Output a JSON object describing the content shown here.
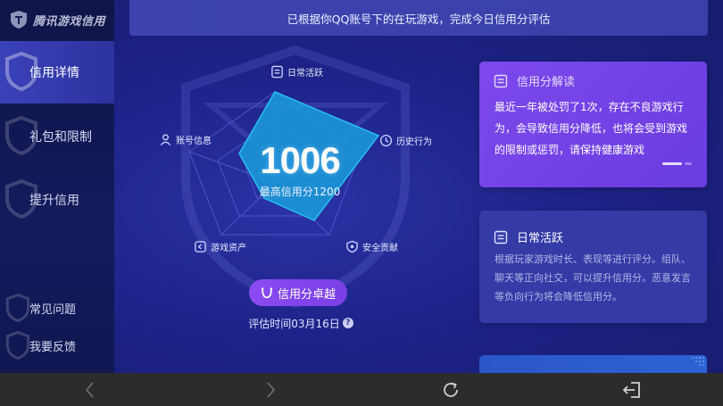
{
  "app": {
    "logo_text": "腾讯游戏信用"
  },
  "sidebar": {
    "items": [
      {
        "label": "信用详情",
        "active": true
      },
      {
        "label": "礼包和限制",
        "active": false
      },
      {
        "label": "提升信用",
        "active": false
      }
    ],
    "bottom_items": [
      {
        "label": "常见问题"
      },
      {
        "label": "我要反馈"
      }
    ]
  },
  "banner": {
    "text": "已根据你QQ账号下的在玩游戏，完成今日信用分评估"
  },
  "radar": {
    "dimensions": [
      {
        "label": "日常活跃",
        "icon": "list-icon"
      },
      {
        "label": "历史行为",
        "icon": "clock-icon"
      },
      {
        "label": "安全贡献",
        "icon": "shield-icon"
      },
      {
        "label": "游戏资产",
        "icon": "asset-icon"
      },
      {
        "label": "账号信息",
        "icon": "user-icon"
      }
    ],
    "score": "1006",
    "max_label": "最高信用分1200",
    "level_label": "信用分卓越",
    "eval_time": "评估时间03月16日",
    "help": "?"
  },
  "cards": {
    "interpretation": {
      "title": "信用分解读",
      "body": "最近一年被处罚了1次，存在不良游戏行为，会导致信用分降低，也将会受到游戏的限制或惩罚，请保持健康游戏"
    },
    "daily": {
      "title": "日常活跃",
      "body": "根据玩家游戏时长、表现等进行评分。组队、聊天等正向社交，可以提升信用分。恶意发言等负向行为将会降低信用分。"
    }
  },
  "colors": {
    "accent": "#7d48ec",
    "radar_fill": "#1b9ad8",
    "sidebar_active": "#3a42b8"
  },
  "system_bar": [
    "back-icon",
    "forward-icon",
    "refresh-icon",
    "exit-icon"
  ]
}
